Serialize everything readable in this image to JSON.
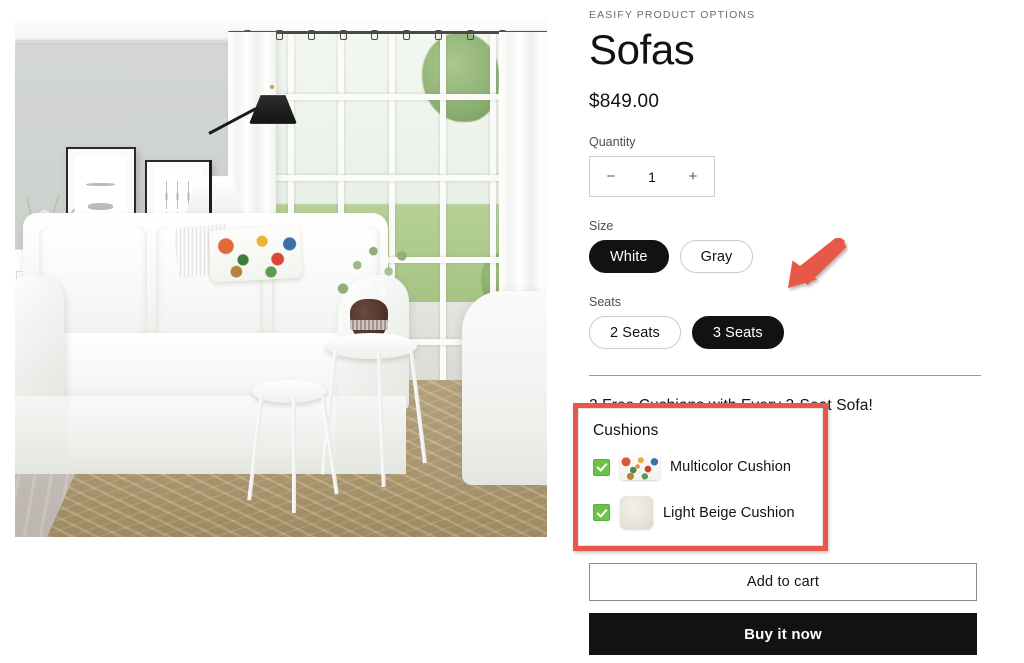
{
  "product": {
    "vendor": "EASIFY PRODUCT OPTIONS",
    "title": "Sofas",
    "price": "$849.00"
  },
  "quantity": {
    "label": "Quantity",
    "decrease": "−",
    "value": "1",
    "increase": "+"
  },
  "options": [
    {
      "label": "Size",
      "choices": [
        {
          "label": "White",
          "selected": true
        },
        {
          "label": "Gray",
          "selected": false
        }
      ]
    },
    {
      "label": "Seats",
      "choices": [
        {
          "label": "2 Seats",
          "selected": false
        },
        {
          "label": "3 Seats",
          "selected": true
        }
      ]
    }
  ],
  "promo": "2 Free Cushions with Every 3-Seat Sofa!",
  "cushions": {
    "title": "Cushions",
    "items": [
      {
        "label": "Multicolor Cushion",
        "checked": true,
        "thumb": "multicolor-cushion-thumb"
      },
      {
        "label": "Light Beige Cushion",
        "checked": true,
        "thumb": "light-beige-cushion-thumb"
      }
    ],
    "highlight_color": "#E8584A"
  },
  "actions": {
    "add_to_cart": "Add to cart",
    "buy_it_now": "Buy it now"
  },
  "annotation": {
    "arrow_color": "#E8584A",
    "points_to": "3 Seats"
  },
  "gallery": {
    "alt": "White three-seat slipcovered sofa in a bright living room with jute rug, side tables and windows"
  }
}
